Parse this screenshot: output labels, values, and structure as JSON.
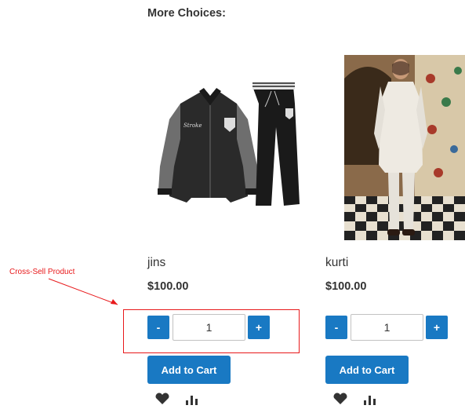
{
  "section": {
    "title": "More Choices:"
  },
  "annotation": {
    "label": "Cross-Sell Product",
    "color": "#e8191b"
  },
  "products": [
    {
      "name": "jins",
      "price": "$100.00",
      "quantity": "1",
      "decrement_label": "-",
      "increment_label": "+",
      "add_to_cart_label": "Add to Cart",
      "image_icon": "tracksuit-image"
    },
    {
      "name": "kurti",
      "price": "$100.00",
      "quantity": "1",
      "decrement_label": "-",
      "increment_label": "+",
      "add_to_cart_label": "Add to Cart",
      "image_icon": "kurta-model-image"
    }
  ],
  "colors": {
    "accent": "#1979c3",
    "text": "#333333",
    "icon": "#333333"
  },
  "icons": [
    "heart-icon",
    "compare-icon"
  ]
}
